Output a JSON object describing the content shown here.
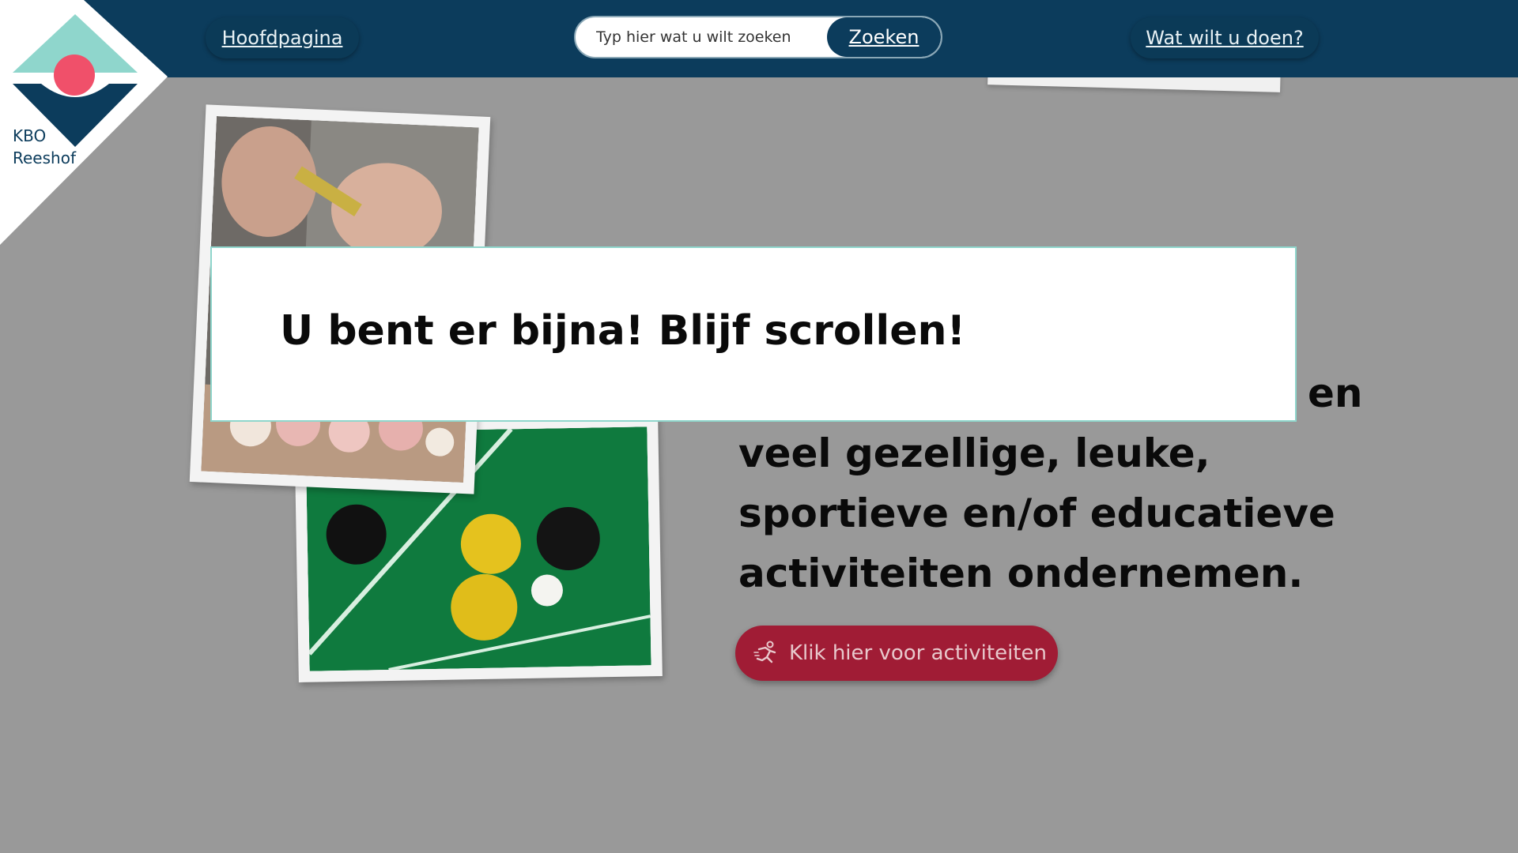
{
  "nav": {
    "home_label": "Hoofdpagina",
    "what_label": "Wat wilt u doen?"
  },
  "search": {
    "placeholder": "Typ hier wat u wilt zoeken",
    "button_label": "Zoeken"
  },
  "logo": {
    "line1": "KBO",
    "line2": "Reeshof",
    "colors": {
      "teal": "#8fd6cc",
      "red": "#f0506a",
      "navy": "#0c3c5c"
    }
  },
  "hero": {
    "lines": [
      "en",
      "veel gezellige, leuke,",
      "sportieve en/of educatieve",
      "activiteiten ondernemen."
    ],
    "cta_label": "Klik hier voor activiteiten",
    "cta_icon": "running-person-icon"
  },
  "popup": {
    "message": "U bent er bijna! Blijf scrollen!"
  },
  "colors": {
    "navbar": "#0c3c5c",
    "cta": "#a01c35",
    "popup_border": "#8fd6cc",
    "page_background": "#999999"
  }
}
